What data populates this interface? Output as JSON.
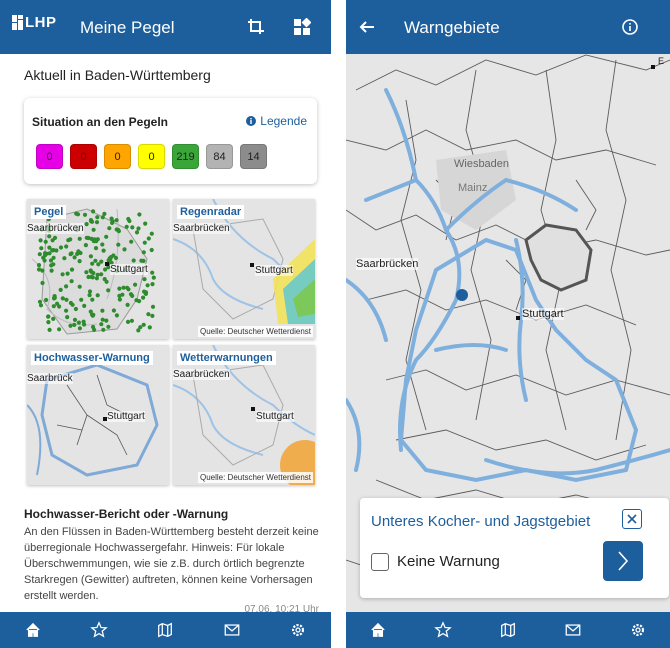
{
  "left": {
    "appbar": {
      "title": "Meine Pegel",
      "logo_text": "LHP"
    },
    "heading": "Aktuell in Baden-Württemberg",
    "situation": {
      "title": "Situation an den Pegeln",
      "legend_label": "Legende",
      "badges": [
        {
          "value": "0",
          "color": "#e600e6",
          "text_color": "#222"
        },
        {
          "value": "0",
          "color": "#cc0000",
          "text_color": "#7a0000"
        },
        {
          "value": "0",
          "color": "#ffa500",
          "text_color": "#222"
        },
        {
          "value": "0",
          "color": "#ffff00",
          "text_color": "#222"
        },
        {
          "value": "219",
          "color": "#3aa63a",
          "text_color": "#222"
        },
        {
          "value": "84",
          "color": "#b3b3b3",
          "text_color": "#222"
        },
        {
          "value": "14",
          "color": "#8c8c8c",
          "text_color": "#222"
        }
      ]
    },
    "tiles": {
      "pegel": {
        "label": "Pegel",
        "city1": "Saarbrücken",
        "city2": "Stuttgart"
      },
      "regenradar": {
        "label": "Regenradar",
        "city1": "Saarbrücken",
        "city2": "Stuttgart",
        "source": "Quelle: Deutscher Wetterdienst"
      },
      "hochwasser": {
        "label": "Hochwasser-Warnung",
        "city1": "Saarbrück",
        "city2": "Stuttgart"
      },
      "wetter": {
        "label": "Wetterwarnungen",
        "city1": "Saarbrücken",
        "city2": "Stuttgart",
        "source": "Quelle: Deutscher Wetterdienst"
      }
    },
    "report": {
      "title": "Hochwasser-Bericht oder -Warnung",
      "text": "An den Flüssen in Baden-Württemberg besteht derzeit keine überregionale Hochwassergefahr. Hinweis: Für lokale Überschwemmungen, wie sie z.B. durch örtlich begrenzte Starkregen (Gewitter) auftreten, können keine Vorhersagen erstellt werden.",
      "timestamp": "07.06. 10:21 Uhr"
    }
  },
  "right": {
    "appbar": {
      "title": "Warngebiete"
    },
    "map": {
      "labels": [
        "Wiesbaden",
        "Mainz",
        "Saarbrücken",
        "Stuttgart"
      ],
      "edge_label": "E"
    },
    "popup": {
      "region": "Unteres Kocher- und Jagstgebiet",
      "status": "Keine Warnung",
      "checked": false
    }
  },
  "nav_icons": [
    "home-icon",
    "star-icon",
    "map-icon",
    "mail-icon",
    "settings-icon"
  ]
}
